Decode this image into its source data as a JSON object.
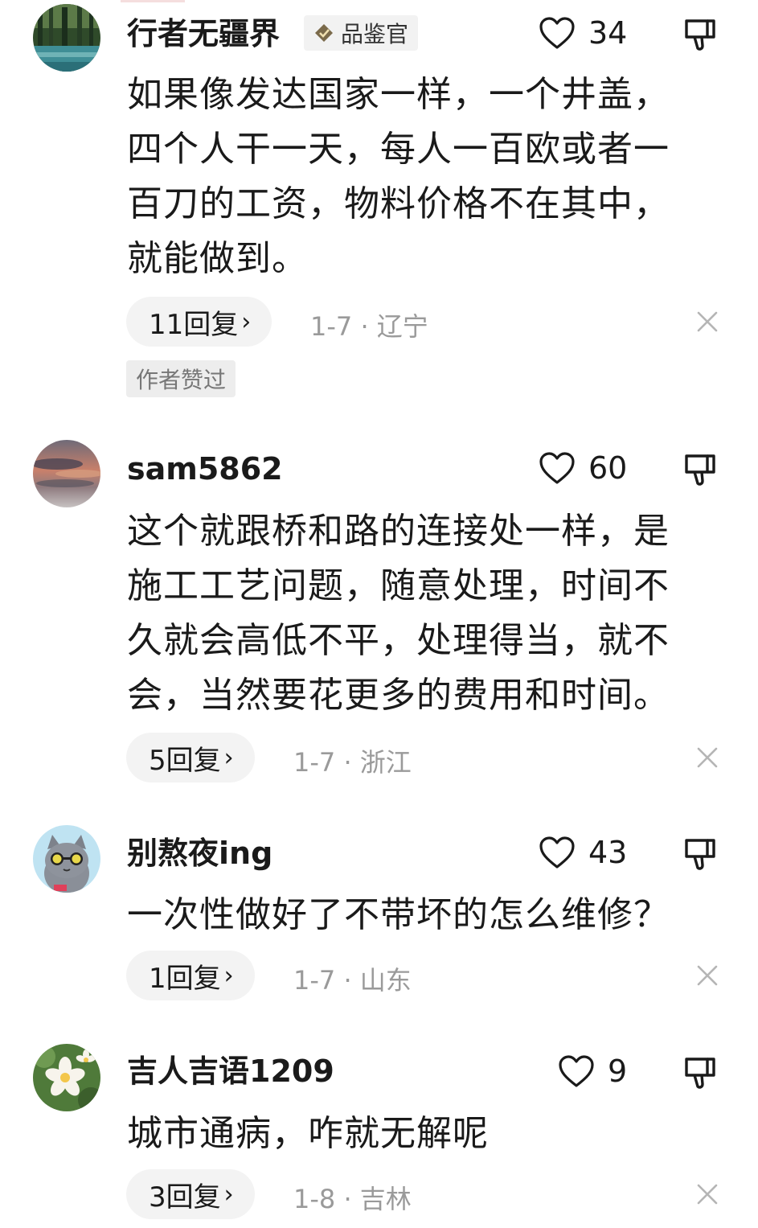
{
  "colors": {
    "text": "#1a1a1a",
    "meta": "#9a9a9a",
    "pill_bg": "#f3f3f3"
  },
  "comments": [
    {
      "username": "行者无疆界",
      "badge": "品鉴官",
      "likes": "34",
      "lines": [
        "如果像发达国家一样，一个井盖，",
        "四个人干一天，每人一百欧或者一",
        "百刀的工资，物料价格不在其中，",
        "就能做到。"
      ],
      "replies": "11回复",
      "chevron": "›",
      "meta": "1-7 · 辽宁",
      "author_liked": "作者赞过",
      "avatar_icon": "forest-lake-avatar"
    },
    {
      "username": "sam5862",
      "likes": "60",
      "lines": [
        "这个就跟桥和路的连接处一样，是",
        "施工工艺问题，随意处理，时间不",
        "久就会高低不平，处理得当，就不",
        "会，当然要花更多的费用和时间。"
      ],
      "replies": "5回复",
      "chevron": "›",
      "meta": "1-7 · 浙江",
      "avatar_icon": "sunset-sky-avatar"
    },
    {
      "username": "别熬夜ing",
      "likes": "43",
      "lines": [
        "一次性做好了不带坏的怎么维修？"
      ],
      "replies": "1回复",
      "chevron": "›",
      "meta": "1-7 · 山东",
      "avatar_icon": "cartoon-cat-sunglasses-avatar"
    },
    {
      "username": "吉人吉语1209",
      "likes": "9",
      "lines": [
        "城市通病，咋就无解呢"
      ],
      "replies": "3回复",
      "chevron": "›",
      "meta": "1-8 · 吉林",
      "avatar_icon": "frangipani-flower-avatar"
    }
  ]
}
